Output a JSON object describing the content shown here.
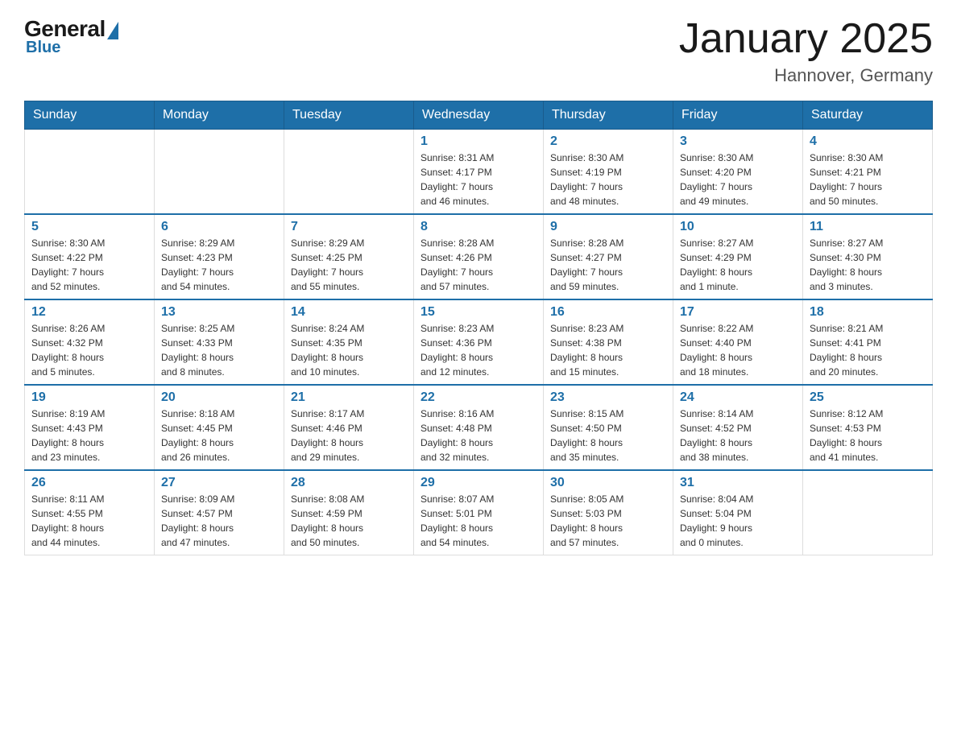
{
  "logo": {
    "general": "General",
    "blue": "Blue"
  },
  "title": "January 2025",
  "subtitle": "Hannover, Germany",
  "days_of_week": [
    "Sunday",
    "Monday",
    "Tuesday",
    "Wednesday",
    "Thursday",
    "Friday",
    "Saturday"
  ],
  "weeks": [
    [
      {
        "day": "",
        "info": ""
      },
      {
        "day": "",
        "info": ""
      },
      {
        "day": "",
        "info": ""
      },
      {
        "day": "1",
        "info": "Sunrise: 8:31 AM\nSunset: 4:17 PM\nDaylight: 7 hours\nand 46 minutes."
      },
      {
        "day": "2",
        "info": "Sunrise: 8:30 AM\nSunset: 4:19 PM\nDaylight: 7 hours\nand 48 minutes."
      },
      {
        "day": "3",
        "info": "Sunrise: 8:30 AM\nSunset: 4:20 PM\nDaylight: 7 hours\nand 49 minutes."
      },
      {
        "day": "4",
        "info": "Sunrise: 8:30 AM\nSunset: 4:21 PM\nDaylight: 7 hours\nand 50 minutes."
      }
    ],
    [
      {
        "day": "5",
        "info": "Sunrise: 8:30 AM\nSunset: 4:22 PM\nDaylight: 7 hours\nand 52 minutes."
      },
      {
        "day": "6",
        "info": "Sunrise: 8:29 AM\nSunset: 4:23 PM\nDaylight: 7 hours\nand 54 minutes."
      },
      {
        "day": "7",
        "info": "Sunrise: 8:29 AM\nSunset: 4:25 PM\nDaylight: 7 hours\nand 55 minutes."
      },
      {
        "day": "8",
        "info": "Sunrise: 8:28 AM\nSunset: 4:26 PM\nDaylight: 7 hours\nand 57 minutes."
      },
      {
        "day": "9",
        "info": "Sunrise: 8:28 AM\nSunset: 4:27 PM\nDaylight: 7 hours\nand 59 minutes."
      },
      {
        "day": "10",
        "info": "Sunrise: 8:27 AM\nSunset: 4:29 PM\nDaylight: 8 hours\nand 1 minute."
      },
      {
        "day": "11",
        "info": "Sunrise: 8:27 AM\nSunset: 4:30 PM\nDaylight: 8 hours\nand 3 minutes."
      }
    ],
    [
      {
        "day": "12",
        "info": "Sunrise: 8:26 AM\nSunset: 4:32 PM\nDaylight: 8 hours\nand 5 minutes."
      },
      {
        "day": "13",
        "info": "Sunrise: 8:25 AM\nSunset: 4:33 PM\nDaylight: 8 hours\nand 8 minutes."
      },
      {
        "day": "14",
        "info": "Sunrise: 8:24 AM\nSunset: 4:35 PM\nDaylight: 8 hours\nand 10 minutes."
      },
      {
        "day": "15",
        "info": "Sunrise: 8:23 AM\nSunset: 4:36 PM\nDaylight: 8 hours\nand 12 minutes."
      },
      {
        "day": "16",
        "info": "Sunrise: 8:23 AM\nSunset: 4:38 PM\nDaylight: 8 hours\nand 15 minutes."
      },
      {
        "day": "17",
        "info": "Sunrise: 8:22 AM\nSunset: 4:40 PM\nDaylight: 8 hours\nand 18 minutes."
      },
      {
        "day": "18",
        "info": "Sunrise: 8:21 AM\nSunset: 4:41 PM\nDaylight: 8 hours\nand 20 minutes."
      }
    ],
    [
      {
        "day": "19",
        "info": "Sunrise: 8:19 AM\nSunset: 4:43 PM\nDaylight: 8 hours\nand 23 minutes."
      },
      {
        "day": "20",
        "info": "Sunrise: 8:18 AM\nSunset: 4:45 PM\nDaylight: 8 hours\nand 26 minutes."
      },
      {
        "day": "21",
        "info": "Sunrise: 8:17 AM\nSunset: 4:46 PM\nDaylight: 8 hours\nand 29 minutes."
      },
      {
        "day": "22",
        "info": "Sunrise: 8:16 AM\nSunset: 4:48 PM\nDaylight: 8 hours\nand 32 minutes."
      },
      {
        "day": "23",
        "info": "Sunrise: 8:15 AM\nSunset: 4:50 PM\nDaylight: 8 hours\nand 35 minutes."
      },
      {
        "day": "24",
        "info": "Sunrise: 8:14 AM\nSunset: 4:52 PM\nDaylight: 8 hours\nand 38 minutes."
      },
      {
        "day": "25",
        "info": "Sunrise: 8:12 AM\nSunset: 4:53 PM\nDaylight: 8 hours\nand 41 minutes."
      }
    ],
    [
      {
        "day": "26",
        "info": "Sunrise: 8:11 AM\nSunset: 4:55 PM\nDaylight: 8 hours\nand 44 minutes."
      },
      {
        "day": "27",
        "info": "Sunrise: 8:09 AM\nSunset: 4:57 PM\nDaylight: 8 hours\nand 47 minutes."
      },
      {
        "day": "28",
        "info": "Sunrise: 8:08 AM\nSunset: 4:59 PM\nDaylight: 8 hours\nand 50 minutes."
      },
      {
        "day": "29",
        "info": "Sunrise: 8:07 AM\nSunset: 5:01 PM\nDaylight: 8 hours\nand 54 minutes."
      },
      {
        "day": "30",
        "info": "Sunrise: 8:05 AM\nSunset: 5:03 PM\nDaylight: 8 hours\nand 57 minutes."
      },
      {
        "day": "31",
        "info": "Sunrise: 8:04 AM\nSunset: 5:04 PM\nDaylight: 9 hours\nand 0 minutes."
      },
      {
        "day": "",
        "info": ""
      }
    ]
  ]
}
